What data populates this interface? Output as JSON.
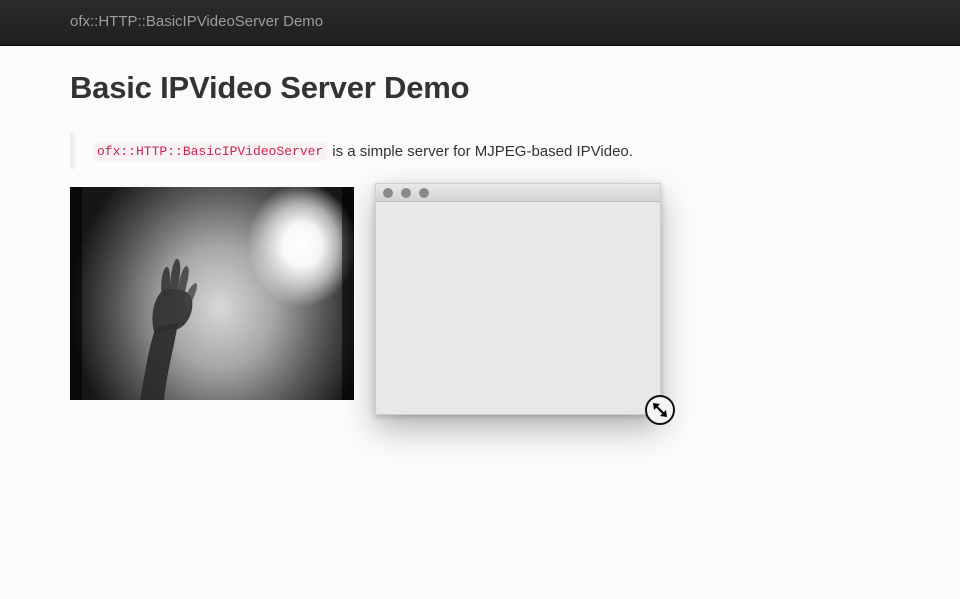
{
  "navbar": {
    "brand": "ofx::HTTP::BasicIPVideoServer Demo"
  },
  "page": {
    "title": "Basic IPVideo Server Demo",
    "intro_code": "ofx::HTTP::BasicIPVideoServer",
    "intro_text": "is a simple server for MJPEG-based IPVideo."
  },
  "video": {
    "icon": "video-stream"
  },
  "popup_window": {
    "buttons": [
      "close-icon",
      "minimize-icon",
      "zoom-icon"
    ]
  },
  "cursor": {
    "icon": "resize-diagonal-icon"
  },
  "colors": {
    "navbar": "#222222",
    "code_text": "#c7254e",
    "code_bg": "#f9f2f4"
  }
}
